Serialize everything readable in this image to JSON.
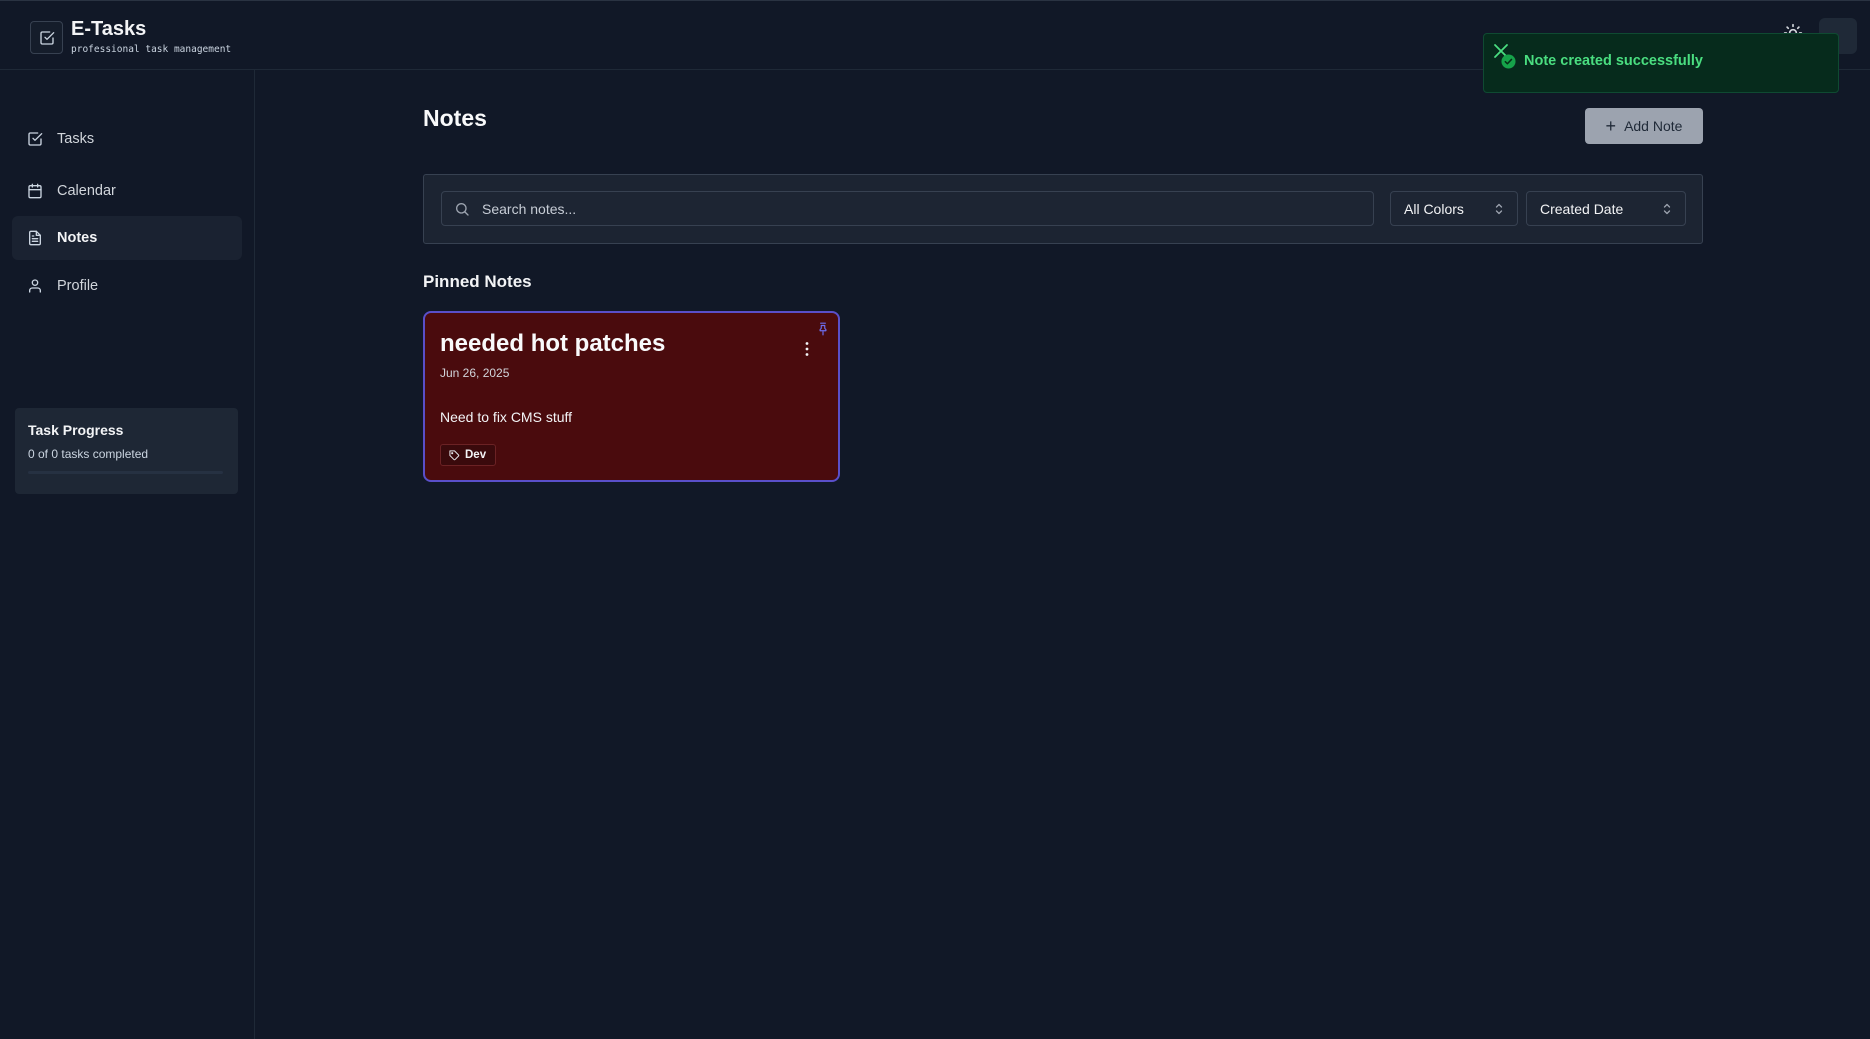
{
  "app": {
    "title": "E-Tasks",
    "subtitle": "professional task management"
  },
  "sidebar": {
    "items": [
      {
        "label": "Tasks",
        "icon": "check-square-icon",
        "active": false
      },
      {
        "label": "Calendar",
        "icon": "calendar-icon",
        "active": false
      },
      {
        "label": "Notes",
        "icon": "file-text-icon",
        "active": true
      },
      {
        "label": "Profile",
        "icon": "user-icon",
        "active": false
      }
    ],
    "progress": {
      "title": "Task Progress",
      "text": "0 of 0 tasks completed",
      "completed": 0,
      "total": 0
    }
  },
  "main": {
    "title": "Notes",
    "add_label": "Add Note",
    "search": {
      "placeholder": "Search notes...",
      "value": ""
    },
    "filters": {
      "color_selected": "All Colors",
      "sort_selected": "Created Date"
    },
    "pinned_title": "Pinned Notes",
    "notes": [
      {
        "title": "needed hot patches",
        "date": "Jun 26, 2025",
        "body": "Need to fix CMS stuff",
        "tag": "Dev",
        "color": "#4a0b0d",
        "pinned": true
      }
    ]
  },
  "toast": {
    "message": "Note created successfully",
    "color": "#4ade80"
  },
  "colors": {
    "background": "#111827",
    "accent": "#5a4fc9",
    "button": "#9ca3af"
  }
}
